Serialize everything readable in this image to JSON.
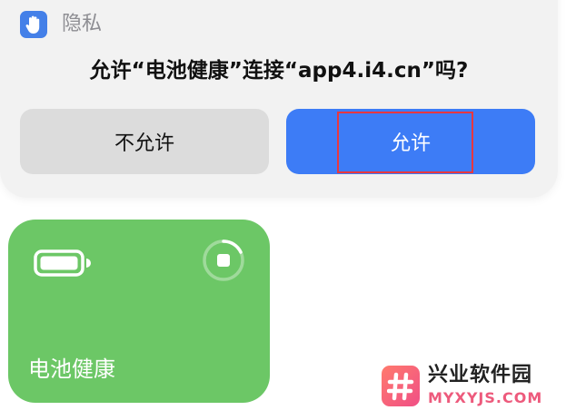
{
  "sheet": {
    "section_label": "隐私",
    "section_icon": "raised-hand-icon",
    "question": "允许“电池健康”连接“app4.i4.cn”吗?",
    "deny_label": "不允许",
    "allow_label": "允许",
    "allow_color": "#3d7cf6",
    "deny_color": "#dcdcdc"
  },
  "tile": {
    "label": "电池健康",
    "color": "#6cc766",
    "icon": "battery-full-icon",
    "action_icon": "stop-progress-icon"
  },
  "watermark": {
    "brand": "兴业软件园",
    "url": "MYXYJS.COM"
  }
}
